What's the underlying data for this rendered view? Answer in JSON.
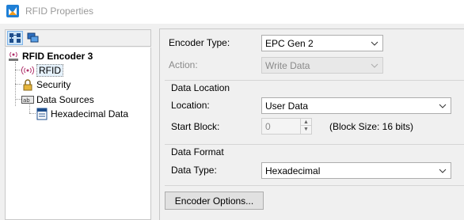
{
  "window": {
    "title": "RFID Properties",
    "icon": "app-logo-icon"
  },
  "toolbar": {
    "buttons": [
      {
        "icon": "tree-view-icon",
        "active": true
      },
      {
        "icon": "layers-icon",
        "active": false
      }
    ]
  },
  "tree": {
    "root": {
      "label": "RFID Encoder 3",
      "icon": "rfid-antenna-icon"
    },
    "items": [
      {
        "label": "RFID",
        "icon": "rfid-signal-icon",
        "selected": true
      },
      {
        "label": "Security",
        "icon": "lock-icon"
      },
      {
        "label": "Data Sources",
        "icon": "text-field-icon"
      },
      {
        "label": "Hexadecimal Data",
        "icon": "data-document-icon"
      }
    ]
  },
  "form": {
    "encoder_type_label": "Encoder Type:",
    "encoder_type_value": "EPC Gen 2",
    "action_label": "Action:",
    "action_value": "Write Data",
    "data_location_heading": "Data Location",
    "location_label": "Location:",
    "location_value": "User Data",
    "start_block_label": "Start Block:",
    "start_block_value": "0",
    "block_size_text": "(Block Size: 16 bits)",
    "data_format_heading": "Data Format",
    "data_type_label": "Data Type:",
    "data_type_value": "Hexadecimal",
    "encoder_options_button": "Encoder Options..."
  },
  "colors": {
    "accent": "#1e7fd6",
    "selection": "#e5f1fb",
    "disabled_text": "#8a8a8a"
  }
}
